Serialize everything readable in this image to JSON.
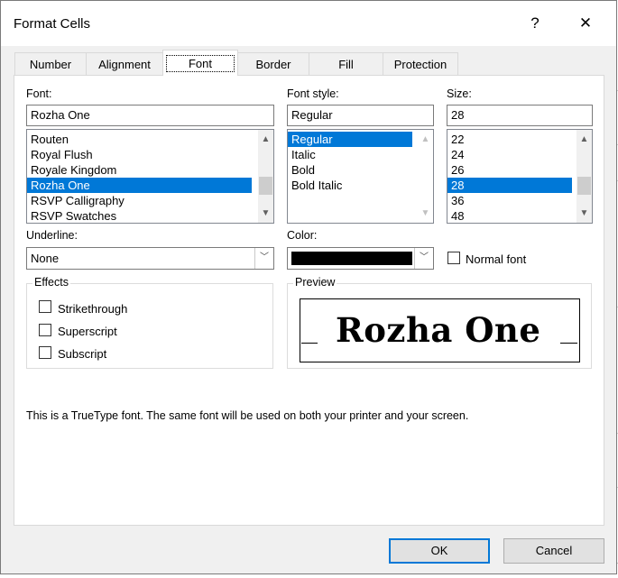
{
  "dialog": {
    "title": "Format Cells",
    "help_label": "?",
    "close_label": "✕"
  },
  "tabs": [
    {
      "label": "Number"
    },
    {
      "label": "Alignment"
    },
    {
      "label": "Font",
      "active": true
    },
    {
      "label": "Border"
    },
    {
      "label": "Fill"
    },
    {
      "label": "Protection"
    }
  ],
  "font": {
    "label": "Font:",
    "value": "Rozha One",
    "list": [
      "Routen",
      "Royal Flush",
      "Royale Kingdom",
      "Rozha One",
      "RSVP Calligraphy",
      "RSVP Swatches"
    ],
    "selected": "Rozha One"
  },
  "font_style": {
    "label": "Font style:",
    "value": "Regular",
    "list": [
      "Regular",
      "Italic",
      "Bold",
      "Bold Italic"
    ],
    "selected": "Regular"
  },
  "size": {
    "label": "Size:",
    "value": "28",
    "list": [
      "22",
      "24",
      "26",
      "28",
      "36",
      "48"
    ],
    "selected": "28"
  },
  "underline": {
    "label": "Underline:",
    "value": "None"
  },
  "color": {
    "label": "Color:",
    "swatch": "#000000"
  },
  "normal_font": {
    "label": "Normal font",
    "checked": false
  },
  "effects": {
    "title": "Effects",
    "strikethrough": "Strikethrough",
    "superscript": "Superscript",
    "subscript": "Subscript"
  },
  "preview": {
    "title": "Preview",
    "sample": "Rozha One"
  },
  "info_text": "This is a TrueType font.  The same font will be used on both your printer and your screen.",
  "buttons": {
    "ok": "OK",
    "cancel": "Cancel"
  },
  "colors": {
    "accent": "#0078d7"
  }
}
